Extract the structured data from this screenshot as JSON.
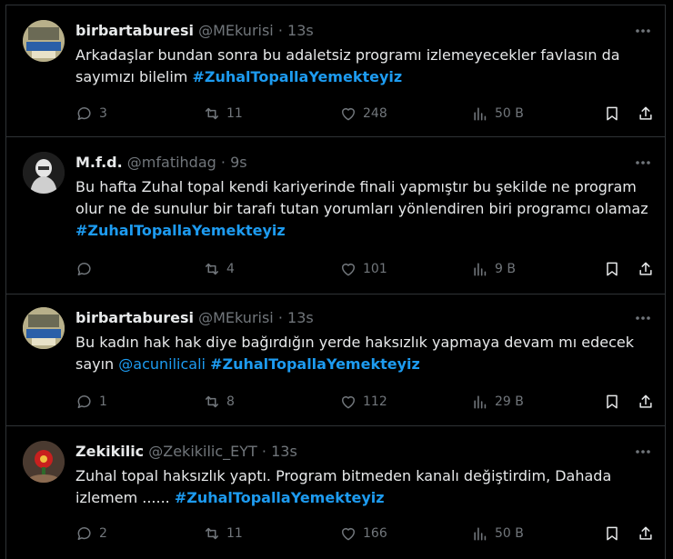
{
  "tweets": [
    {
      "name": "birbartaburesi",
      "handle": "@MEkurisi",
      "dot": "·",
      "time": "13s",
      "text": "Arkadaşlar bundan sonra bu adaletsiz programı izlemeyecekler favlasın da sayımızı bilelim ",
      "mention": "",
      "hashtag": "#ZuhalTopallaYemekteyiz",
      "replies": "3",
      "retweets": "11",
      "likes": "248",
      "views": "50 B"
    },
    {
      "name": "M.f.d.",
      "handle": "@mfatihdag",
      "dot": "·",
      "time": "9s",
      "text": "Bu hafta Zuhal topal kendi kariyerinde finali yapmıştır bu şekilde ne program olur ne de sunulur bir tarafı tutan yorumları yönlendiren biri programcı olamaz ",
      "mention": "",
      "hashtag": "#ZuhalTopallaYemekteyiz",
      "replies": "",
      "retweets": "4",
      "likes": "101",
      "views": "9 B"
    },
    {
      "name": "birbartaburesi",
      "handle": "@MEkurisi",
      "dot": "·",
      "time": "13s",
      "text": "Bu kadın hak hak diye bağırdığın yerde haksızlık yapmaya devam mı edecek sayın ",
      "mention": "@acunilicali",
      "hashtag": "#ZuhalTopallaYemekteyiz",
      "replies": "1",
      "retweets": "8",
      "likes": "112",
      "views": "29 B"
    },
    {
      "name": "Zekikilic",
      "handle": "@Zekikilic_EYT",
      "dot": "·",
      "time": "13s",
      "text": "Zuhal topal haksızlık yaptı. Program bitmeden kanalı değiştirdim, Dahada izlemem ...... ",
      "mention": "",
      "hashtag": "#ZuhalTopallaYemekteyiz",
      "replies": "2",
      "retweets": "11",
      "likes": "166",
      "views": "50 B"
    }
  ],
  "colors": {
    "background": "#000000",
    "text": "#e7e9ea",
    "muted": "#71767b",
    "link": "#1d9bf0",
    "border": "#2f3336"
  },
  "icons": [
    "reply-icon",
    "retweet-icon",
    "like-icon",
    "views-icon",
    "bookmark-icon",
    "share-icon",
    "more-icon"
  ]
}
